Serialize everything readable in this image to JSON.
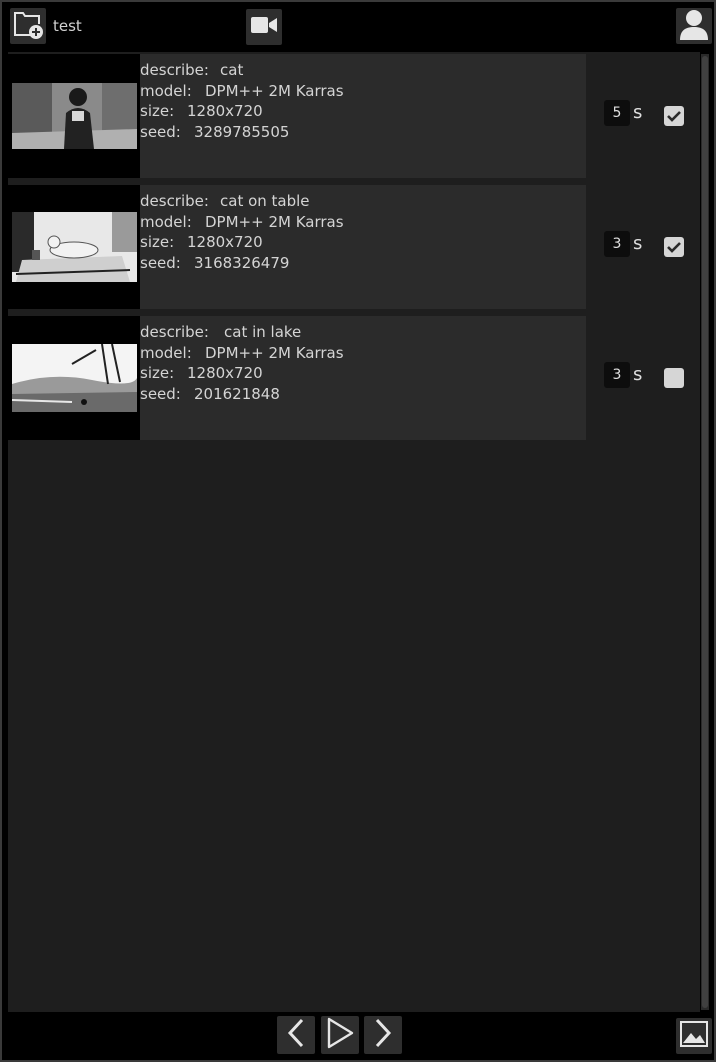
{
  "header": {
    "project_name": "test",
    "icons": [
      "folder-plus-icon",
      "video-camera-icon",
      "user-icon"
    ]
  },
  "items": [
    {
      "describe_key": "describe:",
      "describe": "cat",
      "model_key": "model:",
      "model": "DPM++ 2M Karras",
      "size_key": "size:",
      "size": "1280x720",
      "seed_key": "seed:",
      "seed": "3289785505",
      "duration": "5",
      "unit": "s",
      "checked": true
    },
    {
      "describe_key": "describe:",
      "describe": "cat on table",
      "model_key": "model:",
      "model": "DPM++ 2M Karras",
      "size_key": "size:",
      "size": "1280x720",
      "seed_key": "seed:",
      "seed": "3168326479",
      "duration": "3",
      "unit": "s",
      "checked": true
    },
    {
      "describe_key": "describe:",
      "describe": "cat in lake",
      "model_key": "model:",
      "model": "DPM++ 2M Karras",
      "size_key": "size:",
      "size": "1280x720",
      "seed_key": "seed:",
      "seed": "201621848",
      "duration": "3",
      "unit": "s",
      "checked": false
    }
  ],
  "footer": {
    "icons": [
      "chevron-left-icon",
      "play-icon",
      "chevron-right-icon",
      "image-icon"
    ]
  }
}
